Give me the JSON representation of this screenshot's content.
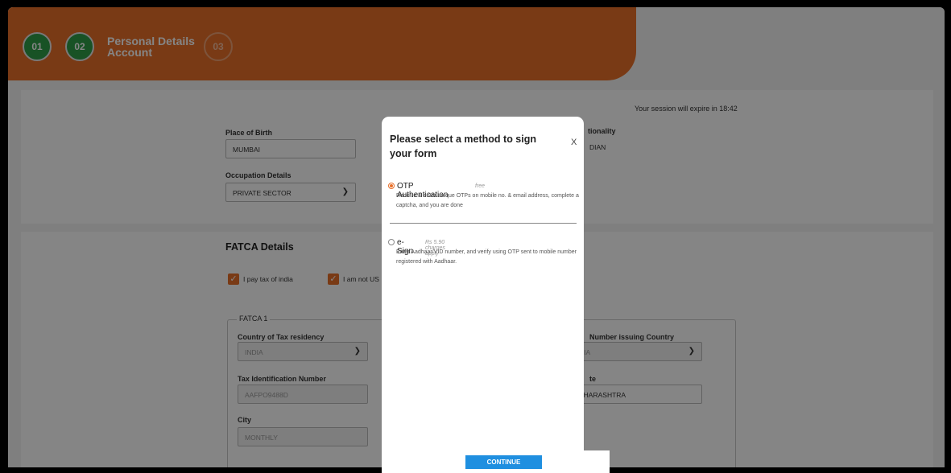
{
  "header": {
    "steps": [
      {
        "label": "01",
        "state": "done"
      },
      {
        "label": "02",
        "state": "done"
      },
      {
        "label": "03",
        "state": "todo"
      }
    ],
    "title_line1": "Personal Details",
    "title_line2": "Account"
  },
  "session_text": "Your session will expire in 18:42",
  "personal": {
    "place_of_birth_label": "Place of Birth",
    "place_of_birth_value": "MUMBAI",
    "nationality_label": "tionality",
    "nationality_value": "DIAN",
    "occupation_label": "Occupation Details",
    "occupation_value": "PRIVATE SECTOR"
  },
  "fatca": {
    "title": "FATCA Details",
    "checkbox1_label": "I pay tax of india",
    "checkbox2_label": "I am not US",
    "fieldset_legend": "FATCA 1",
    "country_label": "Country of Tax residency",
    "country_value": "INDIA",
    "tin_label": "Tax Identification Number",
    "tin_value": "AAFPO9488D",
    "city_label": "City",
    "city_value": "MONTHLY",
    "issuing_label": "Number issuing Country",
    "issuing_value": "DIA",
    "state_label": "te",
    "state_value": "AHARASHTRA"
  },
  "modal": {
    "title": "Please select a method to sign your form",
    "close": "X",
    "otp_name": "OTP Authentication",
    "otp_tag": "free",
    "otp_desc": "Receive & enter unique OTPs on mobile no. & email address, complete a captcha, and you are done",
    "esign_name": "e-Sign",
    "esign_tag": "Rs 5.90 charges apply",
    "esign_desc": "Enter Aadhaar/VID number, and verify using OTP sent to mobile number registered with Aadhaar.",
    "selected": "otp",
    "continue_label": "CONTINUE"
  },
  "colors": {
    "brand_orange": "#e8702a",
    "step_green": "#2f9e48",
    "continue_blue": "#1f8fe0"
  },
  "icons": [
    "chevron-down-icon",
    "checkmark-icon"
  ]
}
